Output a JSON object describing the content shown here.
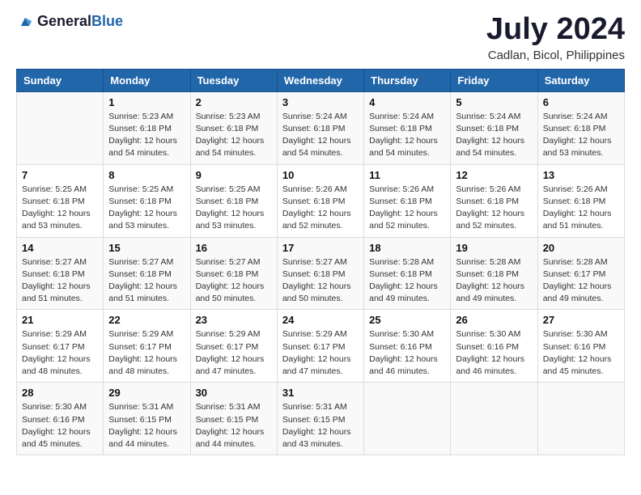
{
  "header": {
    "logo_general": "General",
    "logo_blue": "Blue",
    "month_title": "July 2024",
    "location": "Cadlan, Bicol, Philippines"
  },
  "days_of_week": [
    "Sunday",
    "Monday",
    "Tuesday",
    "Wednesday",
    "Thursday",
    "Friday",
    "Saturday"
  ],
  "weeks": [
    [
      {
        "day": "",
        "info": ""
      },
      {
        "day": "1",
        "info": "Sunrise: 5:23 AM\nSunset: 6:18 PM\nDaylight: 12 hours\nand 54 minutes."
      },
      {
        "day": "2",
        "info": "Sunrise: 5:23 AM\nSunset: 6:18 PM\nDaylight: 12 hours\nand 54 minutes."
      },
      {
        "day": "3",
        "info": "Sunrise: 5:24 AM\nSunset: 6:18 PM\nDaylight: 12 hours\nand 54 minutes."
      },
      {
        "day": "4",
        "info": "Sunrise: 5:24 AM\nSunset: 6:18 PM\nDaylight: 12 hours\nand 54 minutes."
      },
      {
        "day": "5",
        "info": "Sunrise: 5:24 AM\nSunset: 6:18 PM\nDaylight: 12 hours\nand 54 minutes."
      },
      {
        "day": "6",
        "info": "Sunrise: 5:24 AM\nSunset: 6:18 PM\nDaylight: 12 hours\nand 53 minutes."
      }
    ],
    [
      {
        "day": "7",
        "info": "Sunrise: 5:25 AM\nSunset: 6:18 PM\nDaylight: 12 hours\nand 53 minutes."
      },
      {
        "day": "8",
        "info": "Sunrise: 5:25 AM\nSunset: 6:18 PM\nDaylight: 12 hours\nand 53 minutes."
      },
      {
        "day": "9",
        "info": "Sunrise: 5:25 AM\nSunset: 6:18 PM\nDaylight: 12 hours\nand 53 minutes."
      },
      {
        "day": "10",
        "info": "Sunrise: 5:26 AM\nSunset: 6:18 PM\nDaylight: 12 hours\nand 52 minutes."
      },
      {
        "day": "11",
        "info": "Sunrise: 5:26 AM\nSunset: 6:18 PM\nDaylight: 12 hours\nand 52 minutes."
      },
      {
        "day": "12",
        "info": "Sunrise: 5:26 AM\nSunset: 6:18 PM\nDaylight: 12 hours\nand 52 minutes."
      },
      {
        "day": "13",
        "info": "Sunrise: 5:26 AM\nSunset: 6:18 PM\nDaylight: 12 hours\nand 51 minutes."
      }
    ],
    [
      {
        "day": "14",
        "info": "Sunrise: 5:27 AM\nSunset: 6:18 PM\nDaylight: 12 hours\nand 51 minutes."
      },
      {
        "day": "15",
        "info": "Sunrise: 5:27 AM\nSunset: 6:18 PM\nDaylight: 12 hours\nand 51 minutes."
      },
      {
        "day": "16",
        "info": "Sunrise: 5:27 AM\nSunset: 6:18 PM\nDaylight: 12 hours\nand 50 minutes."
      },
      {
        "day": "17",
        "info": "Sunrise: 5:27 AM\nSunset: 6:18 PM\nDaylight: 12 hours\nand 50 minutes."
      },
      {
        "day": "18",
        "info": "Sunrise: 5:28 AM\nSunset: 6:18 PM\nDaylight: 12 hours\nand 49 minutes."
      },
      {
        "day": "19",
        "info": "Sunrise: 5:28 AM\nSunset: 6:18 PM\nDaylight: 12 hours\nand 49 minutes."
      },
      {
        "day": "20",
        "info": "Sunrise: 5:28 AM\nSunset: 6:17 PM\nDaylight: 12 hours\nand 49 minutes."
      }
    ],
    [
      {
        "day": "21",
        "info": "Sunrise: 5:29 AM\nSunset: 6:17 PM\nDaylight: 12 hours\nand 48 minutes."
      },
      {
        "day": "22",
        "info": "Sunrise: 5:29 AM\nSunset: 6:17 PM\nDaylight: 12 hours\nand 48 minutes."
      },
      {
        "day": "23",
        "info": "Sunrise: 5:29 AM\nSunset: 6:17 PM\nDaylight: 12 hours\nand 47 minutes."
      },
      {
        "day": "24",
        "info": "Sunrise: 5:29 AM\nSunset: 6:17 PM\nDaylight: 12 hours\nand 47 minutes."
      },
      {
        "day": "25",
        "info": "Sunrise: 5:30 AM\nSunset: 6:16 PM\nDaylight: 12 hours\nand 46 minutes."
      },
      {
        "day": "26",
        "info": "Sunrise: 5:30 AM\nSunset: 6:16 PM\nDaylight: 12 hours\nand 46 minutes."
      },
      {
        "day": "27",
        "info": "Sunrise: 5:30 AM\nSunset: 6:16 PM\nDaylight: 12 hours\nand 45 minutes."
      }
    ],
    [
      {
        "day": "28",
        "info": "Sunrise: 5:30 AM\nSunset: 6:16 PM\nDaylight: 12 hours\nand 45 minutes."
      },
      {
        "day": "29",
        "info": "Sunrise: 5:31 AM\nSunset: 6:15 PM\nDaylight: 12 hours\nand 44 minutes."
      },
      {
        "day": "30",
        "info": "Sunrise: 5:31 AM\nSunset: 6:15 PM\nDaylight: 12 hours\nand 44 minutes."
      },
      {
        "day": "31",
        "info": "Sunrise: 5:31 AM\nSunset: 6:15 PM\nDaylight: 12 hours\nand 43 minutes."
      },
      {
        "day": "",
        "info": ""
      },
      {
        "day": "",
        "info": ""
      },
      {
        "day": "",
        "info": ""
      }
    ]
  ]
}
